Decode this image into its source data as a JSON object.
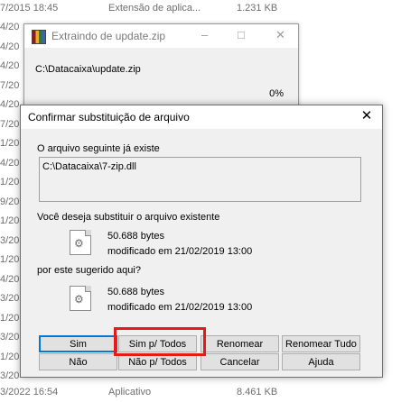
{
  "background_files": {
    "top_row": {
      "date": "7/2015 18:45",
      "type": "Extensão de aplica...",
      "size": "1.231 KB"
    },
    "side_dates": [
      "4/20",
      "4/20",
      "4/20",
      "7/20",
      "4/20",
      "7/20",
      "1/20",
      "4/20",
      "1/20",
      "9/20",
      "1/20",
      "3/20",
      "1/20",
      "4/20",
      "3/20",
      "1/20",
      "3/20",
      "1/20",
      "3/20"
    ],
    "bottom_row": {
      "date": "3/2022 16:54",
      "type": "Aplicativo",
      "size": "8.461 KB"
    }
  },
  "extract_window": {
    "title": "Extraindo de update.zip",
    "path": "C:\\Datacaixa\\update.zip",
    "percent": "0%",
    "icon": "winrar-archive-icon"
  },
  "dialog": {
    "title": "Confirmar substituição de arquivo",
    "exists_label": "O arquivo seguinte já existe",
    "existing_path": "C:\\Datacaixa\\7-zip.dll",
    "replace_question": "Você deseja substituir o arquivo existente",
    "existing_file": {
      "size": "50.688 bytes",
      "modified": "modificado em 21/02/2019 13:00"
    },
    "with_question": "por este sugerido aqui?",
    "new_file": {
      "size": "50.688 bytes",
      "modified": "modificado em 21/02/2019 13:00"
    },
    "buttons": {
      "yes": "Sim",
      "yes_all": "Sim p/ Todos",
      "rename": "Renomear",
      "rename_all": "Renomear Tudo",
      "no": "Não",
      "no_all": "Não p/ Todos",
      "cancel": "Cancelar",
      "help": "Ajuda"
    }
  },
  "colors": {
    "highlight": "#e41b1b",
    "default_button_border": "#0078d7"
  }
}
